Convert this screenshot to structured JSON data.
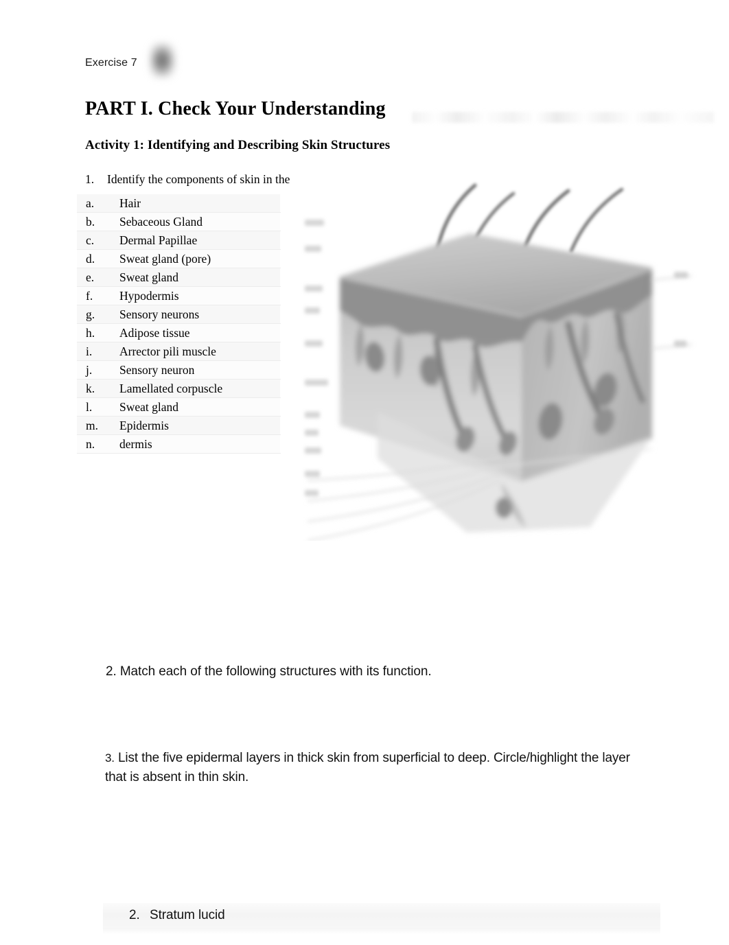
{
  "document": {
    "header_label": "Exercise 7",
    "part_title": "PART I. Check Your Understanding",
    "activity_title": "Activity 1: Identifying and Describing Skin Structures"
  },
  "question_1": {
    "number": "1.",
    "text": "Identify the components of skin in the",
    "items": [
      {
        "letter": "a.",
        "label": "Hair"
      },
      {
        "letter": "b.",
        "label": "Sebaceous Gland"
      },
      {
        "letter": "c.",
        "label": "Dermal Papillae"
      },
      {
        "letter": "d.",
        "label": "Sweat gland (pore)"
      },
      {
        "letter": "e.",
        "label": "Sweat gland"
      },
      {
        "letter": "f.",
        "label": "Hypodermis"
      },
      {
        "letter": "g.",
        "label": "Sensory neurons"
      },
      {
        "letter": "h.",
        "label": "Adipose tissue"
      },
      {
        "letter": "i.",
        "label": "Arrector pili muscle"
      },
      {
        "letter": "j.",
        "label": "Sensory neuron"
      },
      {
        "letter": "k.",
        "label": "Lamellated corpuscle"
      },
      {
        "letter": "l.",
        "label": "Sweat gland"
      },
      {
        "letter": "m.",
        "label": "Epidermis"
      },
      {
        "letter": "n.",
        "label": "dermis"
      }
    ]
  },
  "figure": {
    "name": "skin-cross-section-diagram",
    "description": "Blurred grayscale three-dimensional block diagram of a skin cross-section with hair shafts emerging from the surface and unreadable leader-line labels on the left and right"
  },
  "question_2": {
    "text": "2. Match each of the following structures with its function."
  },
  "question_3": {
    "number": "3.",
    "text": " List the five epidermal layers in thick skin from superficial to deep. Circle/highlight the layer that is absent in thin skin."
  },
  "answer_item": {
    "number": "2.",
    "text": "Stratum lucid"
  },
  "colors": {
    "page_background": "#ffffff",
    "text": "#000000",
    "row_shade": "#f7f7f7",
    "row_rule": "#ececec",
    "band": "#f4f4f4"
  }
}
